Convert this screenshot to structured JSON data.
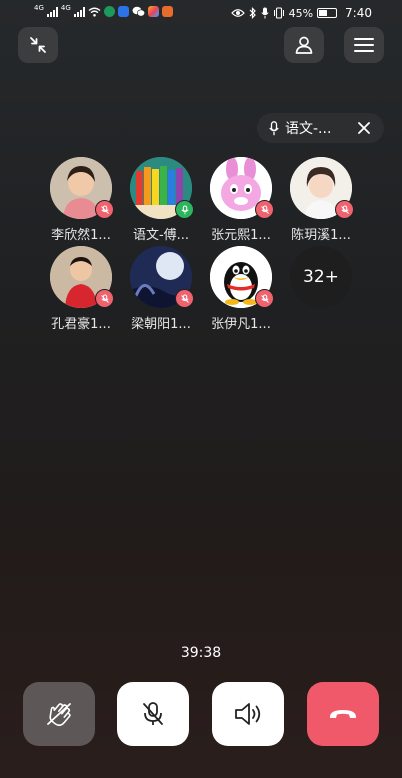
{
  "status_bar": {
    "network_1": "4G",
    "network_2": "4G",
    "battery_percent": "45%",
    "time": "7:40"
  },
  "channel": {
    "name": "语文-..."
  },
  "members": [
    {
      "name": "李欣然1...",
      "mic": "muted"
    },
    {
      "name": "语文-傅...",
      "mic": "on"
    },
    {
      "name": "张元熙1...",
      "mic": "muted"
    },
    {
      "name": "陈玥溪1...",
      "mic": "muted"
    },
    {
      "name": "孔君豪1...",
      "mic": "muted"
    },
    {
      "name": "梁朝阳1...",
      "mic": "muted"
    },
    {
      "name": "张伊凡1...",
      "mic": "muted"
    }
  ],
  "more_members": "32+",
  "call_timer": "39:38",
  "colors": {
    "hangup": "#f0596a",
    "muted_badge": "#f0626e",
    "active_badge": "#2db55d"
  }
}
